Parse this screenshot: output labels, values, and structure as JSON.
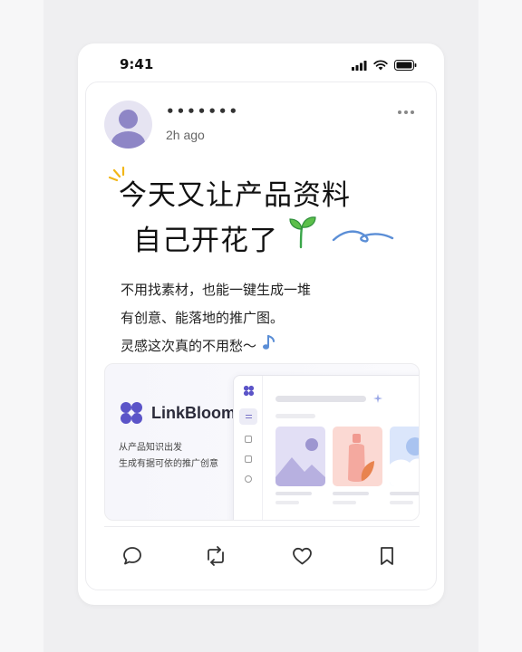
{
  "status_bar": {
    "time": "9:41"
  },
  "post": {
    "username": "•••••••",
    "timestamp": "2h ago",
    "headline_line1": "今天又让产品资料",
    "headline_line2": "自己开花了",
    "body_line1": "不用找素材，也能一键生成一堆",
    "body_line2": "有创意、能落地的推广图。",
    "body_line3": "灵感这次真的不用愁～"
  },
  "preview": {
    "brand_name": "LinkBloom",
    "tagline_line1": "从产品知识出发",
    "tagline_line2": "生成有据可依的推广创意"
  },
  "actions": {
    "icons": [
      "comment-icon",
      "repost-icon",
      "like-icon",
      "bookmark-icon"
    ]
  },
  "colors": {
    "brand": "#5b54c8",
    "accent_blue": "#5b8ed6",
    "sprout_green": "#3aa64a",
    "spark_yellow": "#f2b617"
  }
}
